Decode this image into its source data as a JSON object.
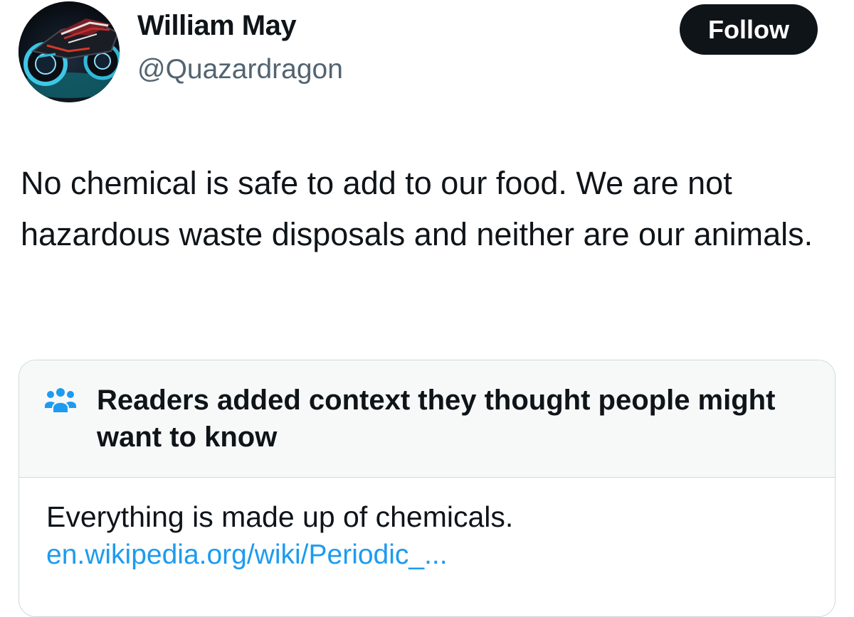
{
  "author": {
    "name": "William May",
    "handle": "@Quazardragon",
    "avatar_icon": "motorcycle-avatar-icon"
  },
  "follow_button": {
    "label": "Follow"
  },
  "tweet": {
    "text": "No chemical is safe to add to our food. We are not hazardous waste disposals and neither are our animals."
  },
  "community_note": {
    "icon": "people-group-icon",
    "title": "Readers added context they thought people might want to know",
    "text": "Everything is made up of chemicals.",
    "link": "en.wikipedia.org/wiki/Periodic_..."
  },
  "colors": {
    "text_primary": "#0f1419",
    "text_secondary": "#536471",
    "accent_blue": "#1d9bf0",
    "button_bg": "#0f1419",
    "note_header_bg": "#f7f9f9",
    "border": "#cfd9de"
  }
}
